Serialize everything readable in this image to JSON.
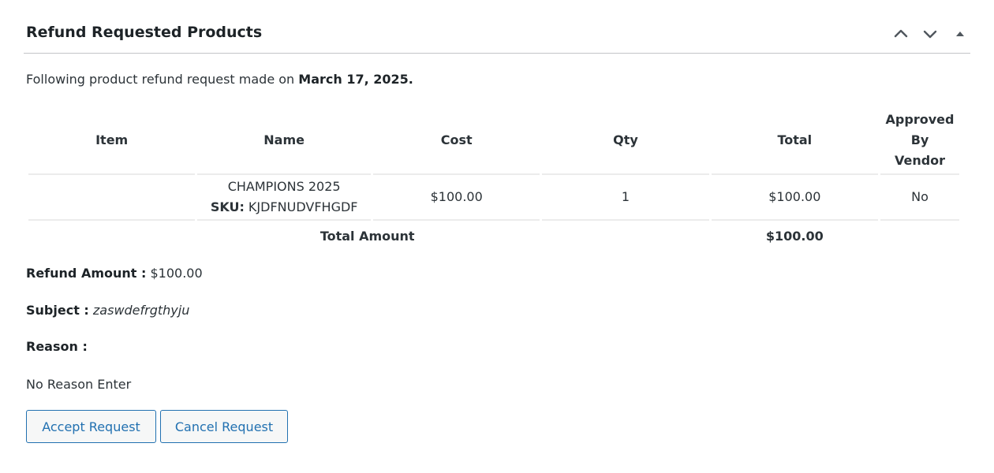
{
  "panel": {
    "title": "Refund Requested Products",
    "icons": [
      "chevron-up-icon",
      "chevron-down-icon",
      "triangle-up-icon"
    ]
  },
  "intro": {
    "text": "Following product refund request made on ",
    "date": "March 17, 2025."
  },
  "table": {
    "headers": {
      "item": "Item",
      "name": "Name",
      "cost": "Cost",
      "qty": "Qty",
      "total": "Total",
      "approved_line1": "Approved",
      "approved_line2": "By",
      "approved_line3": "Vendor"
    },
    "rows": [
      {
        "item": "",
        "name": "CHAMPIONS 2025",
        "sku_label": "SKU:",
        "sku": " KJDFNUDVFHGDF",
        "cost": "$100.00",
        "qty": "1",
        "total": "$100.00",
        "approved": "No"
      }
    ],
    "footer": {
      "label": "Total Amount",
      "total": "$100.00"
    }
  },
  "refund": {
    "amount_label": "Refund Amount :",
    "amount": " $100.00",
    "subject_label": "Subject :",
    "subject": " zaswdefrgthyju",
    "reason_label": "Reason :",
    "reason": "No Reason Enter"
  },
  "actions": {
    "accept": "Accept Request",
    "cancel": "Cancel Request"
  },
  "colors": {
    "accent": "#2271b1",
    "text": "#1d2327",
    "border": "#c3c4c7"
  }
}
